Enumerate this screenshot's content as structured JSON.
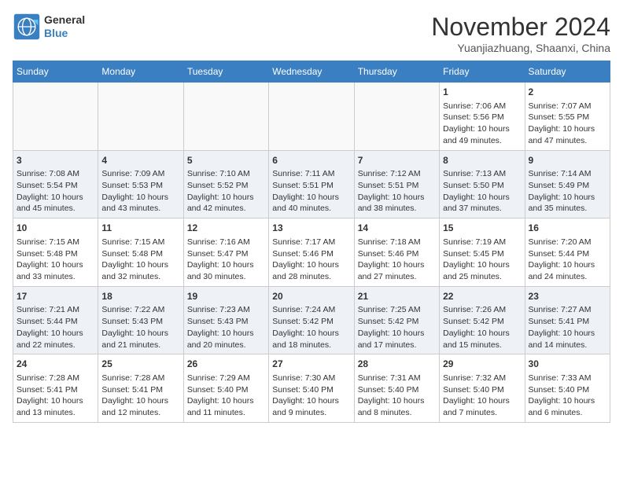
{
  "logo": {
    "line1": "General",
    "line2": "Blue"
  },
  "title": "November 2024",
  "subtitle": "Yuanjiazhuang, Shaanxi, China",
  "days_of_week": [
    "Sunday",
    "Monday",
    "Tuesday",
    "Wednesday",
    "Thursday",
    "Friday",
    "Saturday"
  ],
  "weeks": [
    [
      {
        "day": "",
        "info": ""
      },
      {
        "day": "",
        "info": ""
      },
      {
        "day": "",
        "info": ""
      },
      {
        "day": "",
        "info": ""
      },
      {
        "day": "",
        "info": ""
      },
      {
        "day": "1",
        "info": "Sunrise: 7:06 AM\nSunset: 5:56 PM\nDaylight: 10 hours\nand 49 minutes."
      },
      {
        "day": "2",
        "info": "Sunrise: 7:07 AM\nSunset: 5:55 PM\nDaylight: 10 hours\nand 47 minutes."
      }
    ],
    [
      {
        "day": "3",
        "info": "Sunrise: 7:08 AM\nSunset: 5:54 PM\nDaylight: 10 hours\nand 45 minutes."
      },
      {
        "day": "4",
        "info": "Sunrise: 7:09 AM\nSunset: 5:53 PM\nDaylight: 10 hours\nand 43 minutes."
      },
      {
        "day": "5",
        "info": "Sunrise: 7:10 AM\nSunset: 5:52 PM\nDaylight: 10 hours\nand 42 minutes."
      },
      {
        "day": "6",
        "info": "Sunrise: 7:11 AM\nSunset: 5:51 PM\nDaylight: 10 hours\nand 40 minutes."
      },
      {
        "day": "7",
        "info": "Sunrise: 7:12 AM\nSunset: 5:51 PM\nDaylight: 10 hours\nand 38 minutes."
      },
      {
        "day": "8",
        "info": "Sunrise: 7:13 AM\nSunset: 5:50 PM\nDaylight: 10 hours\nand 37 minutes."
      },
      {
        "day": "9",
        "info": "Sunrise: 7:14 AM\nSunset: 5:49 PM\nDaylight: 10 hours\nand 35 minutes."
      }
    ],
    [
      {
        "day": "10",
        "info": "Sunrise: 7:15 AM\nSunset: 5:48 PM\nDaylight: 10 hours\nand 33 minutes."
      },
      {
        "day": "11",
        "info": "Sunrise: 7:15 AM\nSunset: 5:48 PM\nDaylight: 10 hours\nand 32 minutes."
      },
      {
        "day": "12",
        "info": "Sunrise: 7:16 AM\nSunset: 5:47 PM\nDaylight: 10 hours\nand 30 minutes."
      },
      {
        "day": "13",
        "info": "Sunrise: 7:17 AM\nSunset: 5:46 PM\nDaylight: 10 hours\nand 28 minutes."
      },
      {
        "day": "14",
        "info": "Sunrise: 7:18 AM\nSunset: 5:46 PM\nDaylight: 10 hours\nand 27 minutes."
      },
      {
        "day": "15",
        "info": "Sunrise: 7:19 AM\nSunset: 5:45 PM\nDaylight: 10 hours\nand 25 minutes."
      },
      {
        "day": "16",
        "info": "Sunrise: 7:20 AM\nSunset: 5:44 PM\nDaylight: 10 hours\nand 24 minutes."
      }
    ],
    [
      {
        "day": "17",
        "info": "Sunrise: 7:21 AM\nSunset: 5:44 PM\nDaylight: 10 hours\nand 22 minutes."
      },
      {
        "day": "18",
        "info": "Sunrise: 7:22 AM\nSunset: 5:43 PM\nDaylight: 10 hours\nand 21 minutes."
      },
      {
        "day": "19",
        "info": "Sunrise: 7:23 AM\nSunset: 5:43 PM\nDaylight: 10 hours\nand 20 minutes."
      },
      {
        "day": "20",
        "info": "Sunrise: 7:24 AM\nSunset: 5:42 PM\nDaylight: 10 hours\nand 18 minutes."
      },
      {
        "day": "21",
        "info": "Sunrise: 7:25 AM\nSunset: 5:42 PM\nDaylight: 10 hours\nand 17 minutes."
      },
      {
        "day": "22",
        "info": "Sunrise: 7:26 AM\nSunset: 5:42 PM\nDaylight: 10 hours\nand 15 minutes."
      },
      {
        "day": "23",
        "info": "Sunrise: 7:27 AM\nSunset: 5:41 PM\nDaylight: 10 hours\nand 14 minutes."
      }
    ],
    [
      {
        "day": "24",
        "info": "Sunrise: 7:28 AM\nSunset: 5:41 PM\nDaylight: 10 hours\nand 13 minutes."
      },
      {
        "day": "25",
        "info": "Sunrise: 7:28 AM\nSunset: 5:41 PM\nDaylight: 10 hours\nand 12 minutes."
      },
      {
        "day": "26",
        "info": "Sunrise: 7:29 AM\nSunset: 5:40 PM\nDaylight: 10 hours\nand 11 minutes."
      },
      {
        "day": "27",
        "info": "Sunrise: 7:30 AM\nSunset: 5:40 PM\nDaylight: 10 hours\nand 9 minutes."
      },
      {
        "day": "28",
        "info": "Sunrise: 7:31 AM\nSunset: 5:40 PM\nDaylight: 10 hours\nand 8 minutes."
      },
      {
        "day": "29",
        "info": "Sunrise: 7:32 AM\nSunset: 5:40 PM\nDaylight: 10 hours\nand 7 minutes."
      },
      {
        "day": "30",
        "info": "Sunrise: 7:33 AM\nSunset: 5:40 PM\nDaylight: 10 hours\nand 6 minutes."
      }
    ]
  ]
}
